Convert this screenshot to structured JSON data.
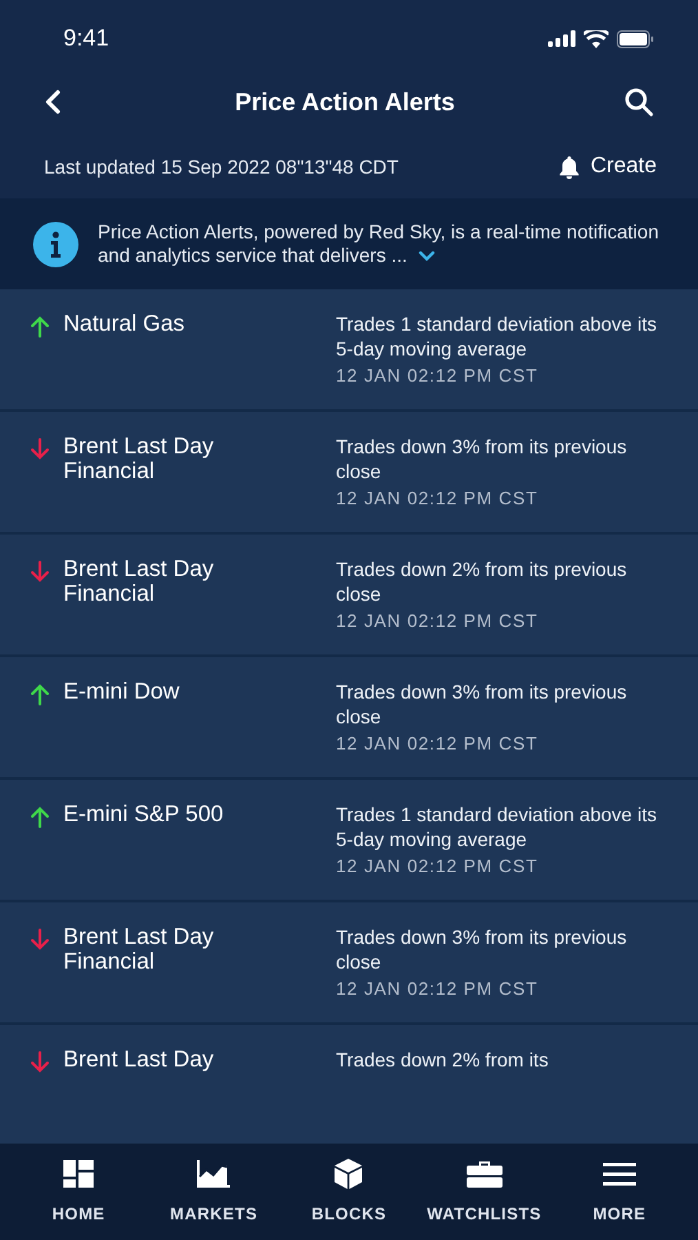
{
  "status_bar": {
    "time": "9:41"
  },
  "header": {
    "title": "Price Action Alerts",
    "last_updated": "Last updated 15 Sep 2022 08\"13\"48 CDT",
    "create_label": "Create"
  },
  "info_banner": {
    "text": "Price Action Alerts, powered by Red Sky, is a real-time notification and analytics service that delivers ..."
  },
  "alerts": [
    {
      "kind": "up",
      "name": "Natural Gas",
      "description": "Trades 1 standard deviation above its 5-day moving average",
      "time": "12 JAN 02:12 PM CST"
    },
    {
      "kind": "down",
      "name": "Brent Last Day Financial",
      "description": "Trades down 3% from its previous close",
      "time": "12 JAN 02:12 PM CST"
    },
    {
      "kind": "down",
      "name": "Brent Last Day Financial",
      "description": "Trades down 2% from its previous close",
      "time": "12 JAN 02:12 PM CST"
    },
    {
      "kind": "up",
      "name": "E-mini Dow",
      "description": "Trades down 3% from its previous close",
      "time": "12 JAN 02:12 PM CST"
    },
    {
      "kind": "up",
      "name": "E-mini S&P 500",
      "description": "Trades 1 standard deviation above its 5-day moving average",
      "time": "12 JAN 02:12 PM CST"
    },
    {
      "kind": "down",
      "name": "Brent Last Day Financial",
      "description": "Trades down 3% from its previous close",
      "time": "12 JAN 02:12 PM CST"
    },
    {
      "kind": "down",
      "name": "Brent Last Day",
      "description": "Trades down 2% from its"
    }
  ],
  "tab_bar": [
    {
      "kind": "home",
      "label": "HOME"
    },
    {
      "kind": "markets",
      "label": "MARKETS"
    },
    {
      "kind": "blocks",
      "label": "BLOCKS"
    },
    {
      "kind": "watchlists",
      "label": "WATCHLISTS"
    },
    {
      "kind": "more",
      "label": "MORE"
    }
  ]
}
